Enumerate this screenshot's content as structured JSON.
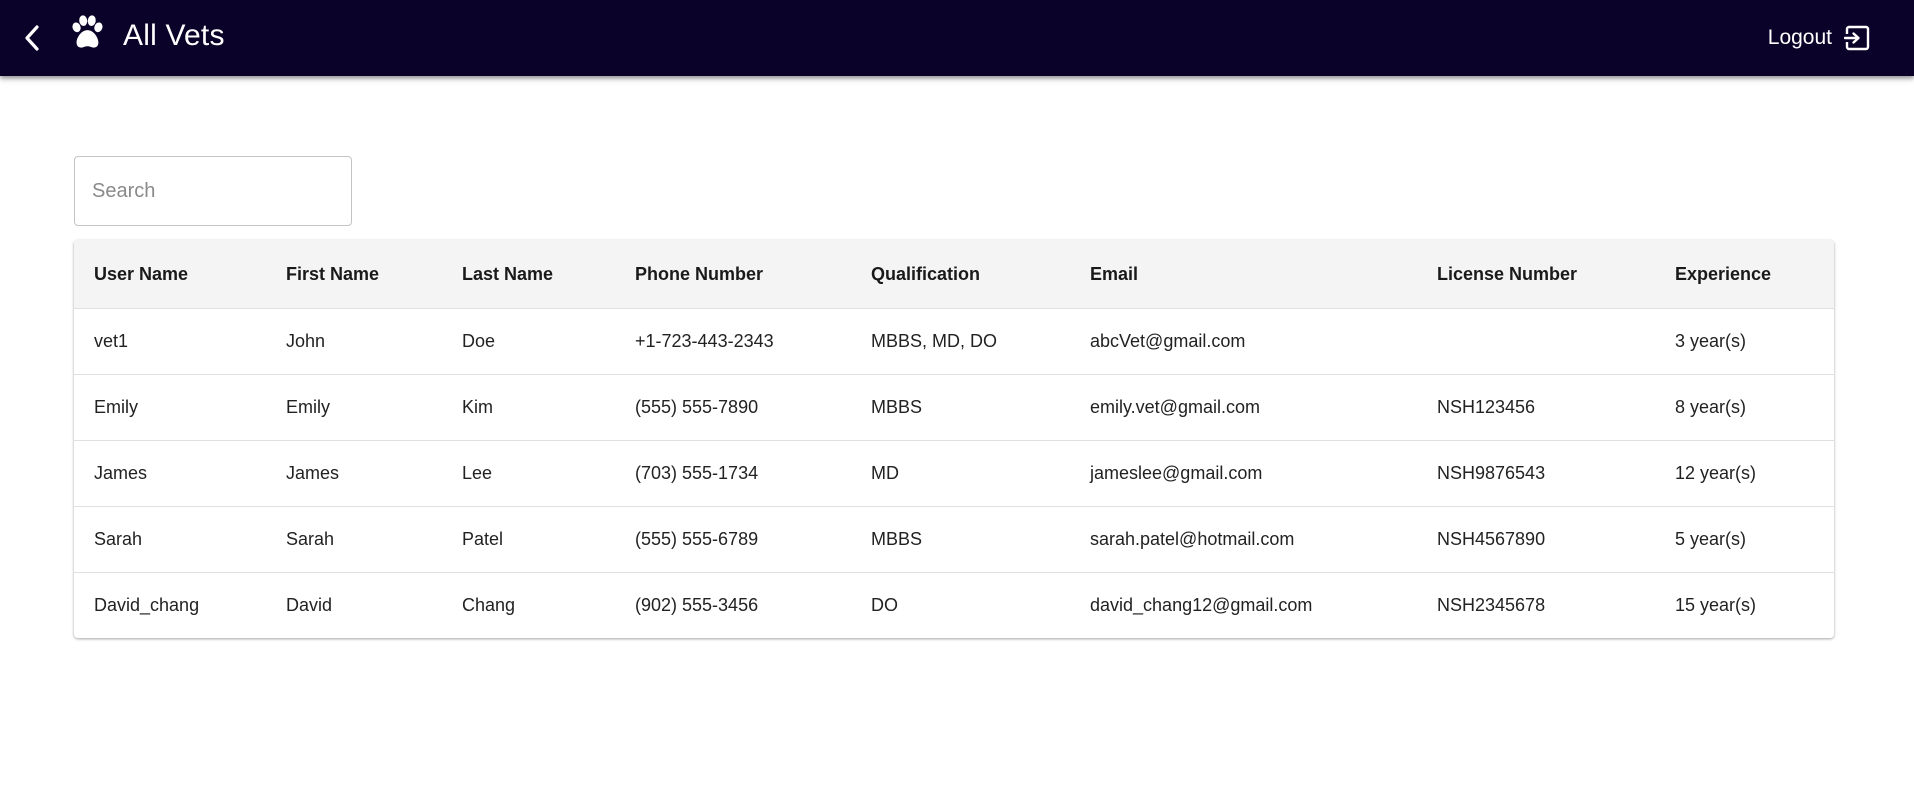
{
  "header": {
    "title": "All Vets",
    "logout_label": "Logout",
    "bg_color": "#0b0229",
    "back_icon": "chevron-left-icon",
    "logo_icon": "paw-icon",
    "logout_icon": "logout-icon"
  },
  "search": {
    "placeholder": "Search",
    "value": ""
  },
  "table": {
    "columns": [
      "User Name",
      "First Name",
      "Last Name",
      "Phone Number",
      "Qualification",
      "Email",
      "License Number",
      "Experience"
    ],
    "rows": [
      [
        "vet1",
        "John",
        "Doe",
        "+1-723-443-2343",
        "MBBS, MD, DO",
        "abcVet@gmail.com",
        "",
        "3 year(s)"
      ],
      [
        "Emily",
        "Emily",
        "Kim",
        "(555) 555-7890",
        "MBBS",
        "emily.vet@gmail.com",
        "NSH123456",
        "8 year(s)"
      ],
      [
        "James",
        "James",
        "Lee",
        "(703) 555-1734",
        "MD",
        "jameslee@gmail.com",
        "NSH9876543",
        "12 year(s)"
      ],
      [
        "Sarah",
        "Sarah",
        "Patel",
        "(555) 555-6789",
        "MBBS",
        "sarah.patel@hotmail.com",
        "NSH4567890",
        "5 year(s)"
      ],
      [
        "David_chang",
        "David",
        "Chang",
        "(902) 555-3456",
        "DO",
        "david_chang12@gmail.com",
        "NSH2345678",
        "15 year(s)"
      ]
    ]
  }
}
